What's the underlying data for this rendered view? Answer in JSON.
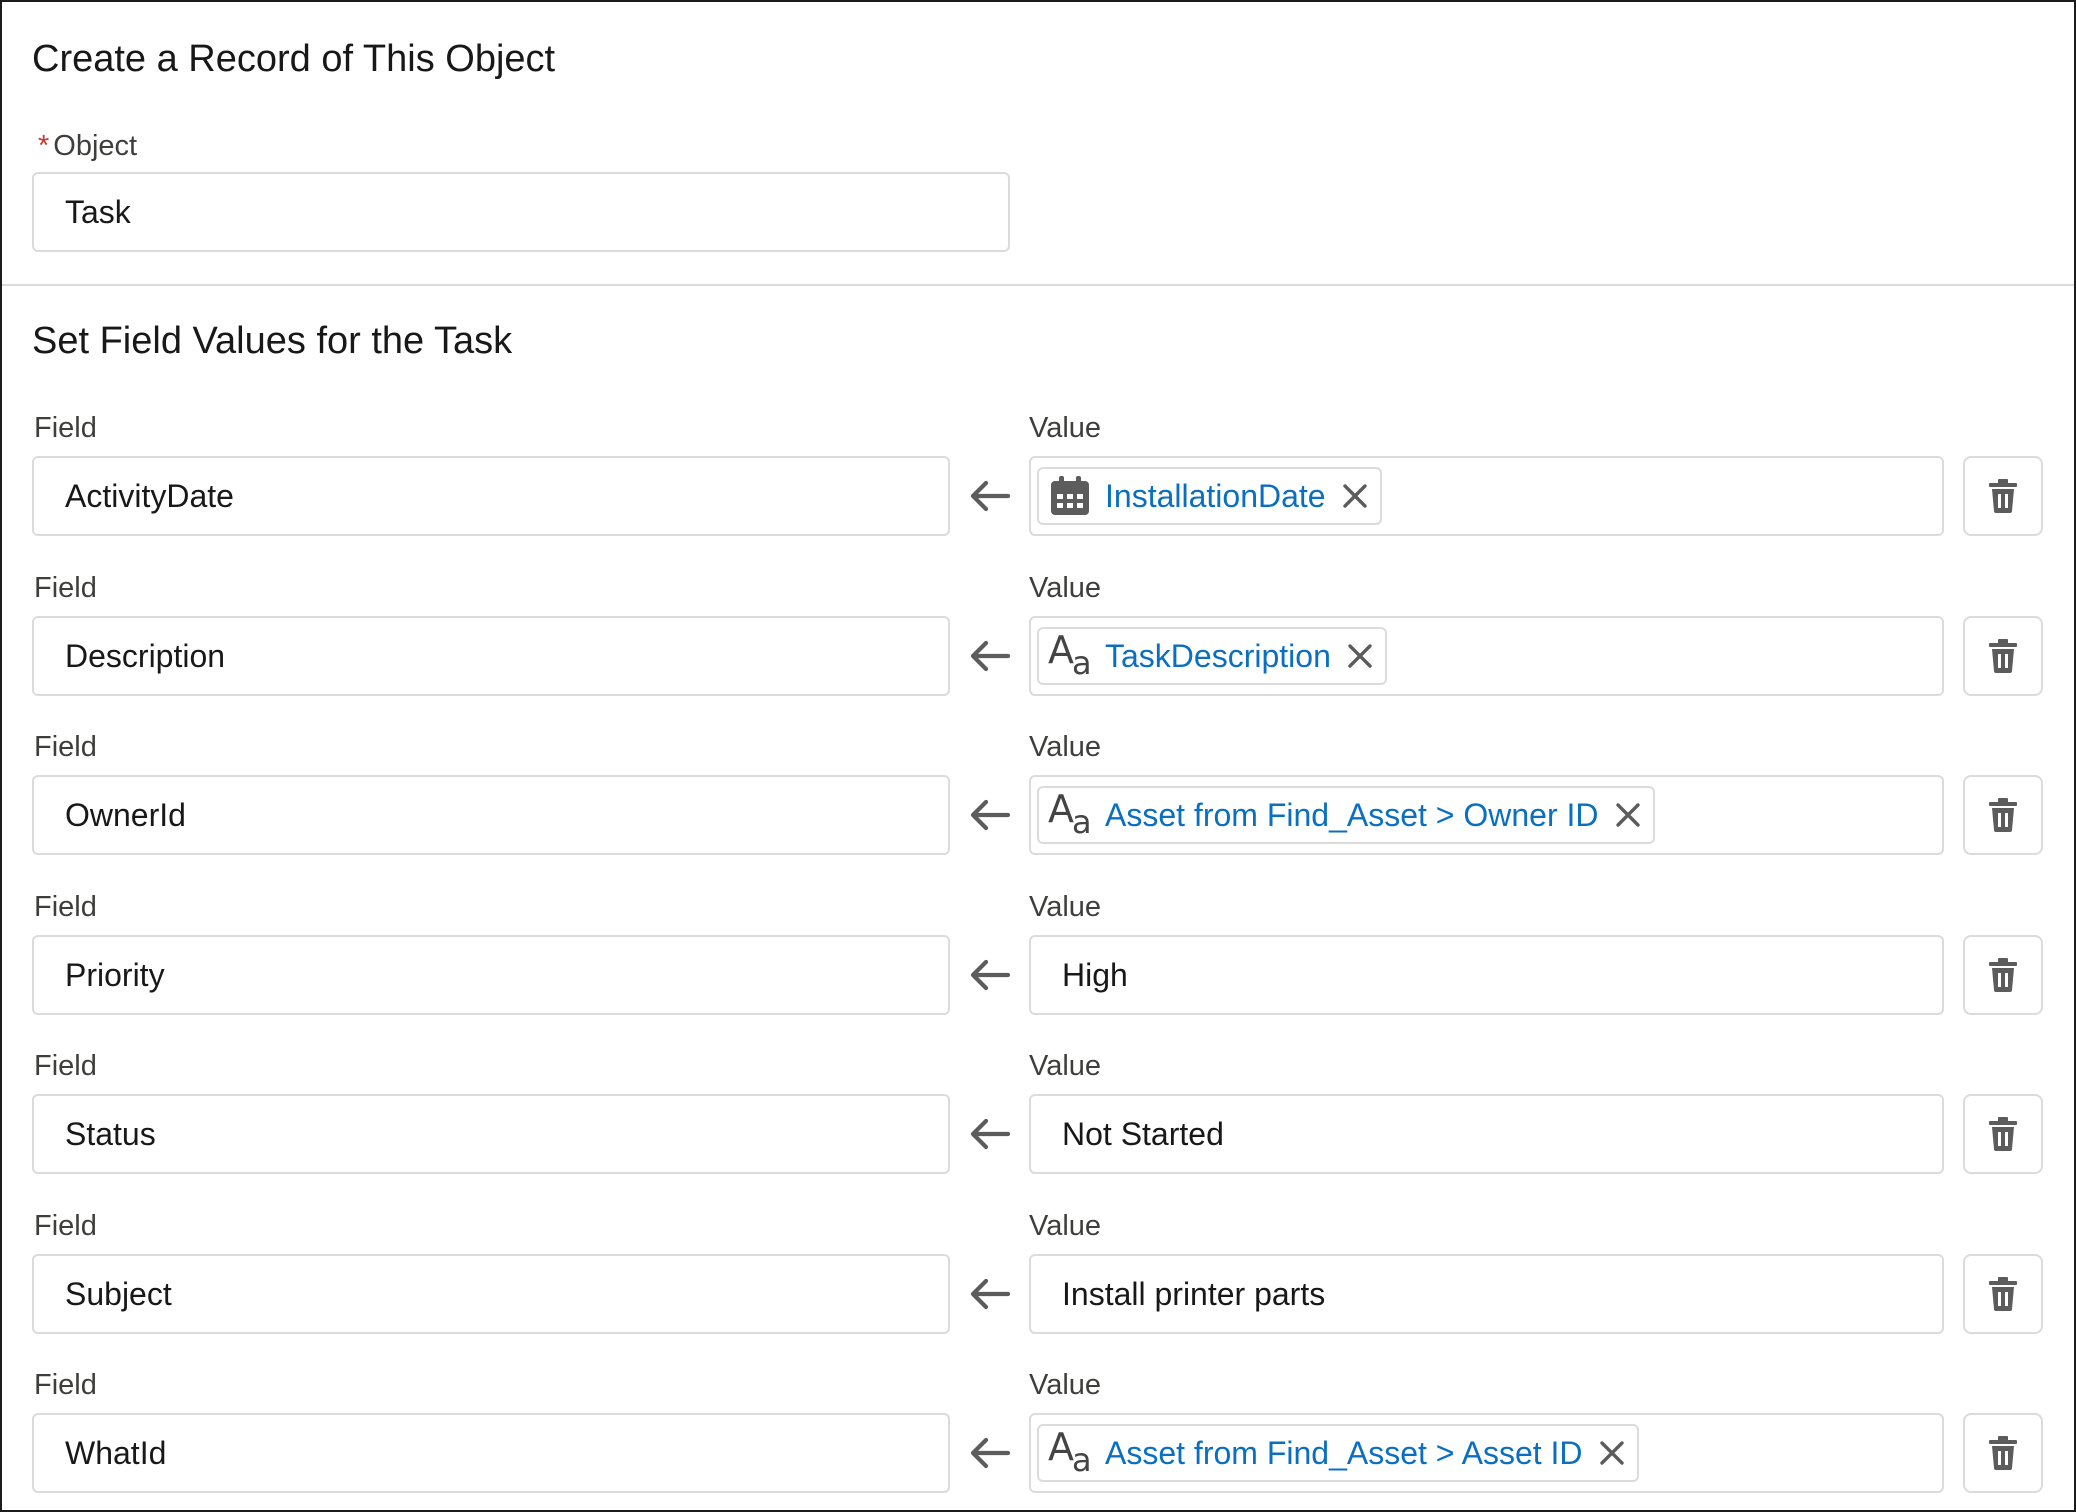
{
  "section1": {
    "title": "Create a Record of This Object",
    "object_label": "Object",
    "required_mark": "*",
    "object_value": "Task"
  },
  "section2": {
    "title": "Set Field Values for the Task"
  },
  "assignments": [
    {
      "field_label": "Field",
      "field": "ActivityDate",
      "value_label": "Value",
      "value_type": "pill",
      "value": "InstallationDate",
      "icon": "calendar-icon"
    },
    {
      "field_label": "Field",
      "field": "Description",
      "value_label": "Value",
      "value_type": "pill",
      "value": "TaskDescription",
      "icon": "text-format-icon"
    },
    {
      "field_label": "Field",
      "field": "OwnerId",
      "value_label": "Value",
      "value_type": "pill",
      "value": "Asset from Find_Asset > Owner ID",
      "icon": "text-format-icon"
    },
    {
      "field_label": "Field",
      "field": "Priority",
      "value_label": "Value",
      "value_type": "text",
      "value": "High"
    },
    {
      "field_label": "Field",
      "field": "Status",
      "value_label": "Value",
      "value_type": "text",
      "value": "Not Started"
    },
    {
      "field_label": "Field",
      "field": "Subject",
      "value_label": "Value",
      "value_type": "text",
      "value": "Install printer parts"
    },
    {
      "field_label": "Field",
      "field": "WhatId",
      "value_label": "Value",
      "value_type": "pill",
      "value": "Asset from Find_Asset > Asset ID",
      "icon": "text-format-icon"
    }
  ],
  "colors": {
    "pill_text": "#0b6fc1",
    "required": "#c23934",
    "border": "#dddbda",
    "icon": "#5c5c5c"
  }
}
